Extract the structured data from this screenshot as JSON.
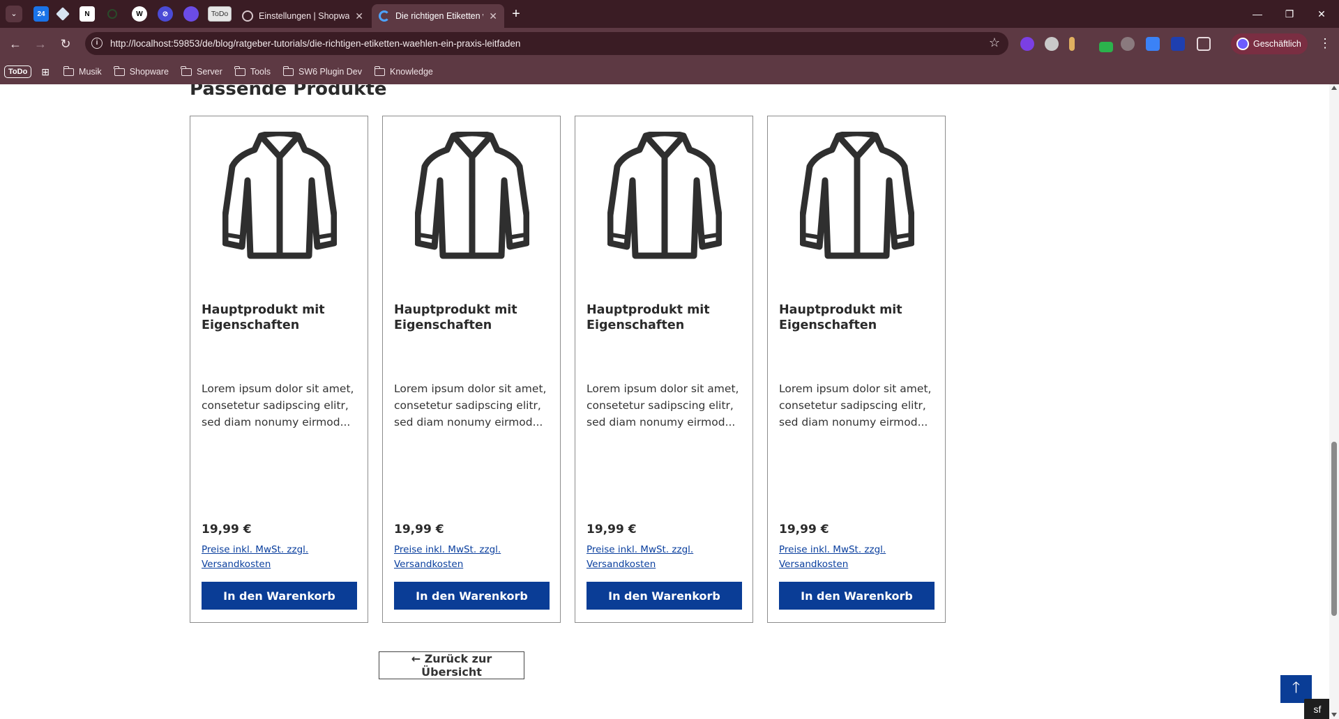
{
  "browser": {
    "pinned_tabs": [
      "calendar-24",
      "cube-app",
      "notion",
      "circle-app",
      "wordpress",
      "shield-app",
      "purple-app",
      "ToDo"
    ],
    "todo_tab_label": "ToDo",
    "calendar_label": "24",
    "tabs": [
      {
        "title": "Einstellungen | Shopware Admi",
        "active": false
      },
      {
        "title": "Die richtigen Etiketten wählen |",
        "active": true
      }
    ],
    "url": "http://localhost:59853/de/blog/ratgeber-tutorials/die-richtigen-etiketten-waehlen-ein-praxis-leitfaden",
    "profile_label": "Geschäftlich",
    "bookmarks": {
      "todo_label": "ToDo",
      "folders": [
        "Musik",
        "Shopware",
        "Server",
        "Tools",
        "SW6 Plugin Dev",
        "Knowledge"
      ]
    }
  },
  "page": {
    "section_title": "Passende Produkte",
    "products": [
      {
        "name": "Hauptprodukt mit Eigenschaften",
        "description": "Lorem ipsum dolor sit amet, consetetur sadipscing elitr, sed diam nonumy eirmod...",
        "price": "19,99 €",
        "vat_note": "Preise inkl. MwSt. zzgl. Versandkosten",
        "button": "In den Warenkorb",
        "icon": "jacket-icon"
      },
      {
        "name": "Hauptprodukt mit Eigenschaften",
        "description": "Lorem ipsum dolor sit amet, consetetur sadipscing elitr, sed diam nonumy eirmod...",
        "price": "19,99 €",
        "vat_note": "Preise inkl. MwSt. zzgl. Versandkosten",
        "button": "In den Warenkorb",
        "icon": "jacket-icon"
      },
      {
        "name": "Hauptprodukt mit Eigenschaften",
        "description": "Lorem ipsum dolor sit amet, consetetur sadipscing elitr, sed diam nonumy eirmod...",
        "price": "19,99 €",
        "vat_note": "Preise inkl. MwSt. zzgl. Versandkosten",
        "button": "In den Warenkorb",
        "icon": "jacket-icon"
      },
      {
        "name": "Hauptprodukt mit Eigenschaften",
        "description": "Lorem ipsum dolor sit amet, consetetur sadipscing elitr, sed diam nonumy eirmod...",
        "price": "19,99 €",
        "vat_note": "Preise inkl. MwSt. zzgl. Versandkosten",
        "button": "In den Warenkorb",
        "icon": "jacket-icon"
      }
    ],
    "back_button": "← Zurück zur Übersicht"
  },
  "colors": {
    "primary": "#0a3d96",
    "link": "#0a3f9e",
    "browser_frame": "#3a1c24",
    "browser_toolbar": "#5d3943"
  }
}
